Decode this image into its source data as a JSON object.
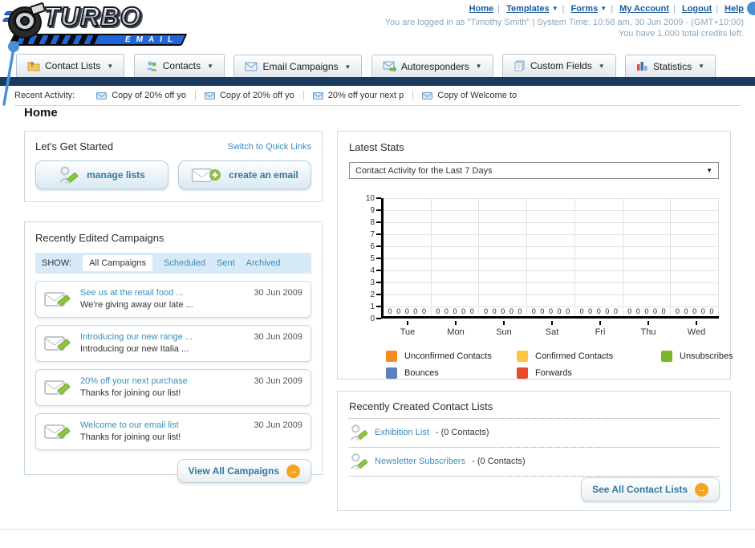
{
  "header": {
    "logo": {
      "title": "TURBO",
      "subtitle": "EMAIL"
    },
    "nav_links": [
      {
        "label": "Home"
      },
      {
        "label": "Templates",
        "has_dropdown": true
      },
      {
        "label": "Forms",
        "has_dropdown": true
      },
      {
        "label": "My Account"
      },
      {
        "label": "Logout"
      },
      {
        "label": "Help"
      }
    ],
    "login_info": "You are logged in as \"Timothy Smith\" | System Time: 10:58 am, 30 Jun 2009 - (GMT+10:00)",
    "credits_info": "You have 1,000 total credits left."
  },
  "main_nav": {
    "tabs": [
      {
        "label": "Contact Lists",
        "icon": "contact-lists-folder-icon"
      },
      {
        "label": "Contacts",
        "icon": "contacts-people-icon"
      },
      {
        "label": "Email Campaigns",
        "icon": "envelope-icon"
      },
      {
        "label": "Autoresponders",
        "icon": "envelope-arrow-icon"
      },
      {
        "label": "Custom Fields",
        "icon": "stacked-pages-icon"
      },
      {
        "label": "Statistics",
        "icon": "bar-chart-icon"
      }
    ]
  },
  "recent_activity": {
    "label": "Recent Activity:",
    "items": [
      "Copy of 20% off yo",
      "Copy of 20% off yo",
      "20% off your next p",
      "Copy of Welcome to"
    ]
  },
  "page_title": "Home",
  "get_started": {
    "title": "Let's Get Started",
    "switch_link": "Switch to Quick Links",
    "manage_lists_label": "manage lists",
    "create_email_label": "create an email"
  },
  "campaigns": {
    "title": "Recently Edited Campaigns",
    "show_label": "SHOW:",
    "tabs": [
      {
        "label": "All Campaigns",
        "selected": true
      },
      {
        "label": "Scheduled",
        "selected": false
      },
      {
        "label": "Sent",
        "selected": false
      },
      {
        "label": "Archived",
        "selected": false
      }
    ],
    "items": [
      {
        "title": "See us at the retail food ...",
        "subtitle": "We're giving away our late ...",
        "date": "30 Jun 2009"
      },
      {
        "title": "Introducing our new range ...",
        "subtitle": "Introducing our new Italia ...",
        "date": "30 Jun 2009"
      },
      {
        "title": "20% off your next purchase",
        "subtitle": "Thanks for joining our list!",
        "date": "30 Jun 2009"
      },
      {
        "title": "Welcome to our email list",
        "subtitle": "Thanks for joining our list!",
        "date": "30 Jun 2009"
      }
    ],
    "view_all_label": "View All Campaigns"
  },
  "latest_stats": {
    "title": "Latest Stats",
    "filter_value": "Contact Activity for the Last 7 Days"
  },
  "chart_data": {
    "type": "bar",
    "title": "Contact Activity for the Last 7 Days",
    "categories": [
      "Tue",
      "Mon",
      "Sun",
      "Sat",
      "Fri",
      "Thu",
      "Wed"
    ],
    "series": [
      {
        "name": "Unconfirmed Contacts",
        "color": "#F68B1F",
        "values": [
          0,
          0,
          0,
          0,
          0,
          0,
          0
        ]
      },
      {
        "name": "Confirmed Contacts",
        "color": "#FDC63F",
        "values": [
          0,
          0,
          0,
          0,
          0,
          0,
          0
        ]
      },
      {
        "name": "Unsubscribes",
        "color": "#76B82A",
        "values": [
          0,
          0,
          0,
          0,
          0,
          0,
          0
        ]
      },
      {
        "name": "Bounces",
        "color": "#5C7FBE",
        "values": [
          0,
          0,
          0,
          0,
          0,
          0,
          0
        ]
      },
      {
        "name": "Forwards",
        "color": "#E84C2B",
        "values": [
          0,
          0,
          0,
          0,
          0,
          0,
          0
        ]
      }
    ],
    "ylim": [
      0,
      10
    ],
    "yticks": [
      0,
      1,
      2,
      3,
      4,
      5,
      6,
      7,
      8,
      9,
      10
    ],
    "grid": true,
    "legend_position": "bottom"
  },
  "contact_lists": {
    "title": "Recently Created Contact Lists",
    "items": [
      {
        "name": "Exhibition List",
        "detail": " - (0 Contacts)"
      },
      {
        "name": "Newsletter Subscribers",
        "detail": " - (0 Contacts)"
      }
    ],
    "see_all_label": "See All Contact Lists"
  },
  "colors": {
    "navy_bar": "#1A3A5F",
    "header_link_blue": "#1A5A9A",
    "body_link_teal": "#3B8DBB",
    "accent_orange": "#F6A41E",
    "muted_login_text": "#8CA7BC"
  }
}
